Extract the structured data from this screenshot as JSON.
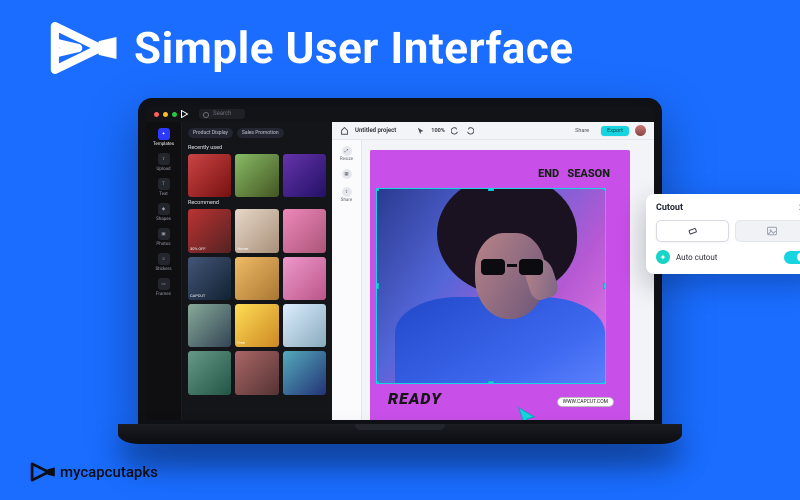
{
  "banner": {
    "headline": "Simple User Interface"
  },
  "titlebar": {
    "search_placeholder": "Search"
  },
  "rail": {
    "items": [
      {
        "label": "Templates"
      },
      {
        "label": "Upload"
      },
      {
        "label": "Text"
      },
      {
        "label": "Shapes"
      },
      {
        "label": "Photos"
      },
      {
        "label": "Stickers"
      },
      {
        "label": "Frames"
      }
    ]
  },
  "library": {
    "chips": [
      "Product Display",
      "Sales Promotion"
    ],
    "section_recent": "Recently used",
    "section_recommend": "Recommend",
    "thumbs_recent": [
      "",
      "",
      ""
    ],
    "thumbs_recommend": [
      "30% OFF",
      "Home.",
      "",
      "CAPCUT",
      "",
      "",
      "",
      "Free",
      "",
      "",
      "",
      ""
    ]
  },
  "project": {
    "title": "Untitled project",
    "zoom": "100%",
    "share_label": "Share",
    "export_label": "Export"
  },
  "side_tools": {
    "items": [
      {
        "label": "Resize"
      },
      {
        "label": ""
      },
      {
        "label": "Share"
      }
    ]
  },
  "artboard": {
    "title_line1": "END",
    "title_line2": "SEASON",
    "title_line3": "",
    "ready": "READY",
    "url": "WWW.CAPCUT.COM"
  },
  "popup": {
    "title": "Cutout",
    "auto_label": "Auto cutout",
    "toggle_on": true
  },
  "watermark": {
    "text": "mycapcutapks"
  },
  "colors": {
    "page_bg": "#1a6dff",
    "accent": "#17d4e0",
    "artboard": "#c84fe8"
  }
}
